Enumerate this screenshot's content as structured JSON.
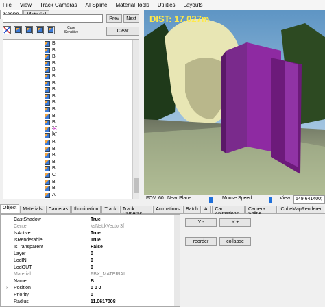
{
  "menu": [
    "File",
    "View",
    "Track Cameras",
    "AI Spline",
    "Material Tools",
    "Utilities",
    "Layouts"
  ],
  "left_tabs": [
    "Scene",
    "Material"
  ],
  "search": {
    "value": "",
    "prev_label": "Prev",
    "next_label": "Next",
    "case_sensitive_label": "Case Sensitive",
    "clear_label": "Clear"
  },
  "tree_items": [
    "B",
    "B",
    "B",
    "B",
    "B",
    "B",
    "B",
    "B",
    "B",
    "B",
    "B",
    "B",
    "B",
    "B",
    "B",
    "B",
    "B",
    "B",
    "B",
    "B",
    "C",
    "B",
    "B",
    "A"
  ],
  "tree_selected_index": 13,
  "viewport": {
    "dist_label": "DIST: 17.027m",
    "fov_label": "FOV: 60",
    "near_plane_label": "Near Plane:",
    "mouse_speed_label": "Mouse Speed:",
    "near_plane_level": 0.6,
    "mouse_speed_level": 0.8,
    "view_label": "View:",
    "view_value": "549.641400; -1"
  },
  "bottom_tabs": [
    "Object",
    "Materials",
    "Cameras",
    "Illumination",
    "Track",
    "Track Cameras",
    "Animations",
    "Batch",
    "AI",
    "Car Animations",
    "Camera Spline",
    "CubeMapRenderer"
  ],
  "properties": [
    {
      "name": "CastShadow",
      "value": "True",
      "dim": false
    },
    {
      "name": "Center",
      "value": "ksNet.kVector3f",
      "dim": true
    },
    {
      "name": "IsActive",
      "value": "True",
      "dim": false
    },
    {
      "name": "IsRenderable",
      "value": "True",
      "dim": false
    },
    {
      "name": "IsTransparent",
      "value": "False",
      "dim": false
    },
    {
      "name": "Layer",
      "value": "0",
      "dim": false
    },
    {
      "name": "LodIN",
      "value": "0",
      "dim": false
    },
    {
      "name": "LodOUT",
      "value": "0",
      "dim": false
    },
    {
      "name": "Material",
      "value": "FBX_MATERIAL",
      "dim": true
    },
    {
      "name": "Name",
      "value": "B",
      "dim": false
    },
    {
      "name": "Position",
      "value": "0 0 0",
      "dim": false,
      "expandable": true
    },
    {
      "name": "Priority",
      "value": "0",
      "dim": false
    },
    {
      "name": "Radius",
      "value": "11.0617008",
      "dim": false
    }
  ],
  "right_buttons": {
    "y_minus": "Y -",
    "y_plus": "Y +",
    "reorder": "reorder",
    "collapse": "collapse"
  }
}
